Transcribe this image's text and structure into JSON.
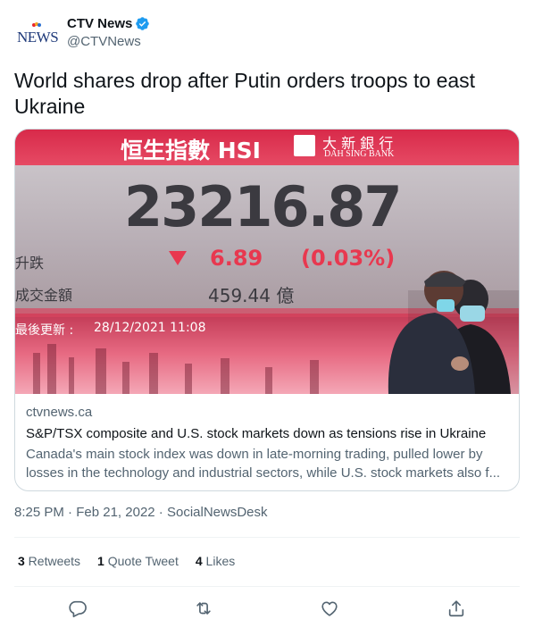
{
  "author": {
    "logo_text": "NEWS",
    "display_name": "CTV News",
    "handle": "@CTVNews",
    "verified": true
  },
  "tweet": {
    "text": "World shares drop after Putin orders troops to east Ukraine"
  },
  "image": {
    "board_title": "恒生指數 HSI",
    "bank_name_cn": "大 新 銀 行",
    "bank_name_en": "DAH SING BANK",
    "index_value": "23216.87",
    "change_label": "升跌",
    "change_value": "6.89",
    "change_percent": "(0.03%)",
    "turnover_label": "成交金額",
    "turnover_value": "459.44 億",
    "update_label": "最後更新 :",
    "update_time": "28/12/2021 11:08"
  },
  "card": {
    "domain": "ctvnews.ca",
    "title": "S&P/TSX composite and U.S. stock markets down as tensions rise in Ukraine",
    "description": "Canada's main stock index was down in late-morning trading, pulled lower by losses in the technology and industrial sectors, while U.S. stock markets also f..."
  },
  "meta": {
    "time": "8:25 PM",
    "sep1": " · ",
    "date": "Feb 21, 2022",
    "sep2": " · ",
    "source": "SocialNewsDesk"
  },
  "stats": {
    "retweets_count": "3",
    "retweets_label": " Retweets",
    "quotes_count": "1",
    "quotes_label": " Quote Tweet",
    "likes_count": "4",
    "likes_label": " Likes"
  },
  "colors": {
    "verified": "#1d9bf0",
    "secondary_text": "#536471",
    "border": "#cfd9de",
    "board_red": "#e8384f"
  },
  "icons": [
    "reply-icon",
    "retweet-icon",
    "like-icon",
    "share-icon",
    "verified-badge-icon"
  ]
}
